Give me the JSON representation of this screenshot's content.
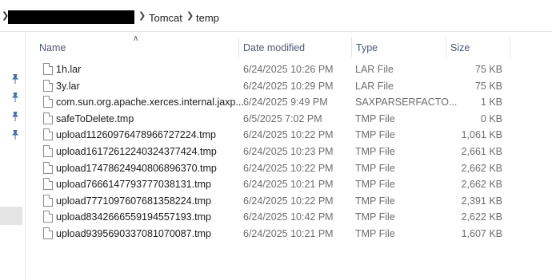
{
  "breadcrumb": {
    "items": [
      {
        "label": "Tomcat"
      },
      {
        "label": "temp"
      }
    ]
  },
  "columns": {
    "name": "Name",
    "date_modified": "Date modified",
    "type": "Type",
    "size": "Size"
  },
  "sort": {
    "column": "name",
    "direction": "ascending"
  },
  "files": [
    {
      "name": "1h.lar",
      "date": "6/24/2025 10:26 PM",
      "type": "LAR File",
      "size": "75 KB"
    },
    {
      "name": "3y.lar",
      "date": "6/24/2025 10:29 PM",
      "type": "LAR File",
      "size": "75 KB"
    },
    {
      "name": "com.sun.org.apache.xerces.internal.jaxp....",
      "date": "6/24/2025 9:49 PM",
      "type": "SAXPARSERFACTO...",
      "size": "1 KB"
    },
    {
      "name": "safeToDelete.tmp",
      "date": "6/5/2025 7:02 PM",
      "type": "TMP File",
      "size": "0 KB"
    },
    {
      "name": "upload1126097647896672722​4.tmp",
      "date": "6/24/2025 10:22 PM",
      "type": "TMP File",
      "size": "1,061 KB"
    },
    {
      "name": "upload16172612240324377424.tmp",
      "date": "6/24/2025 10:23 PM",
      "type": "TMP File",
      "size": "2,661 KB"
    },
    {
      "name": "upload17478624940806896370.tmp",
      "date": "6/24/2025 10:22 PM",
      "type": "TMP File",
      "size": "2,662 KB"
    },
    {
      "name": "upload7666147793777038131.tmp",
      "date": "6/24/2025 10:21 PM",
      "type": "TMP File",
      "size": "2,662 KB"
    },
    {
      "name": "upload7771097607681358224.tmp",
      "date": "6/24/2025 10:22 PM",
      "type": "TMP File",
      "size": "2,391 KB"
    },
    {
      "name": "upload8342666559194557193.tmp",
      "date": "6/24/2025 10:42 PM",
      "type": "TMP File",
      "size": "2,622 KB"
    },
    {
      "name": "upload9395690337081070087.tmp",
      "date": "6/24/2025 10:21 PM",
      "type": "TMP File",
      "size": "1,607 KB"
    }
  ],
  "icons": {
    "breadcrumb_separator": "chevron-right-icon",
    "pin": "pin-icon",
    "file": "file-icon",
    "sort": "sort-ascending-icon"
  },
  "colors": {
    "header_text": "#4a5a73",
    "secondary_text": "#6d6d6d",
    "pin_color": "#4a6fa5"
  }
}
